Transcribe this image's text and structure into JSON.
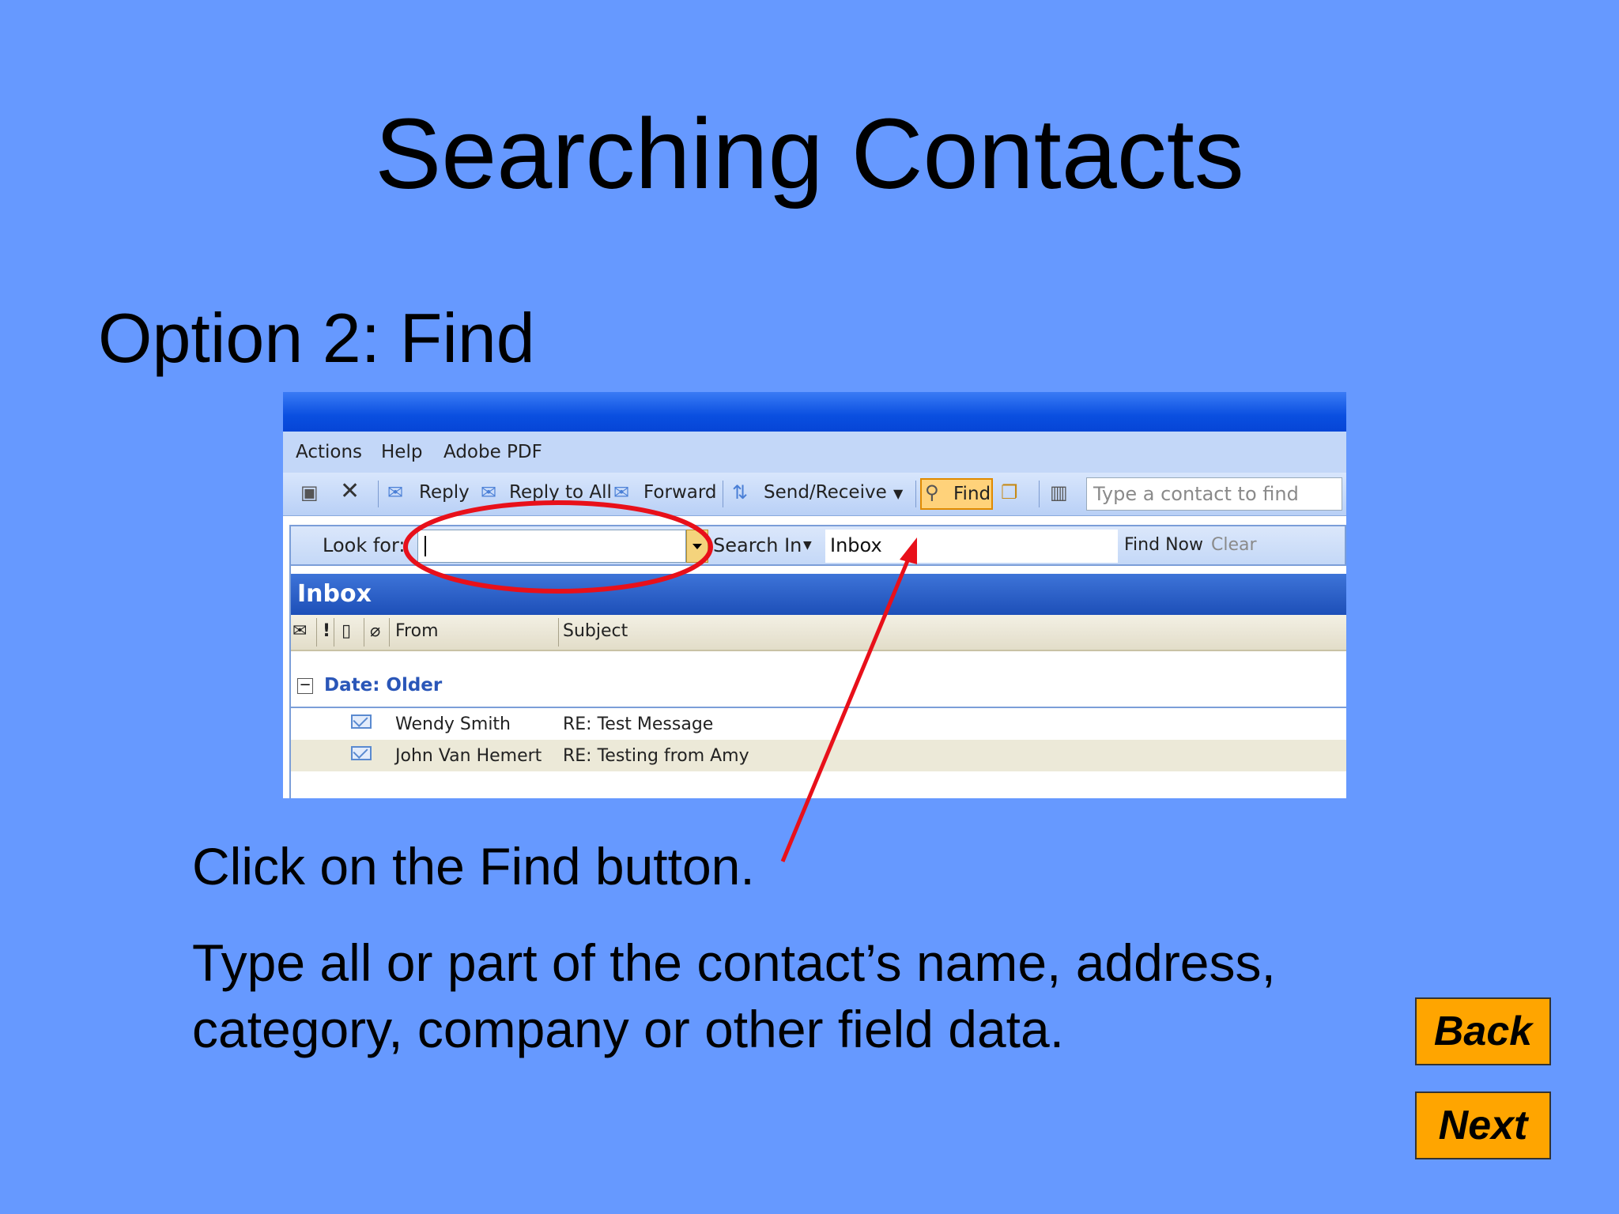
{
  "slide": {
    "title": "Searching Contacts",
    "subtitle": "Option 2:  Find",
    "instructions": [
      "Click on the Find button.",
      "Type all or part of the contact’s name, address,",
      "category, company or other field data."
    ],
    "back_label": "Back",
    "next_label": "Next"
  },
  "screenshot": {
    "menu": [
      "Actions",
      "Help",
      "Adobe PDF"
    ],
    "toolbar": {
      "reply": "Reply",
      "reply_all": "Reply to All",
      "forward": "Forward",
      "send_receive": "Send/Receive",
      "find": "Find",
      "contact_placeholder": "Type a contact to find"
    },
    "findbar": {
      "look_for": "Look for:",
      "look_for_value": "",
      "search_in": "Search In",
      "search_in_value": "Inbox",
      "find_now": "Find Now",
      "clear": "Clear"
    },
    "folder": "Inbox",
    "columns": {
      "from": "From",
      "subject": "Subject"
    },
    "group": "Date: Older",
    "messages": [
      {
        "from": "Wendy Smith",
        "subject": "RE: Test Message"
      },
      {
        "from": "John Van Hemert",
        "subject": "RE: Testing from Amy"
      }
    ]
  },
  "annotation_color": "#e8101a",
  "colors": {
    "background": "#6699ff",
    "button": "#ffa500"
  }
}
